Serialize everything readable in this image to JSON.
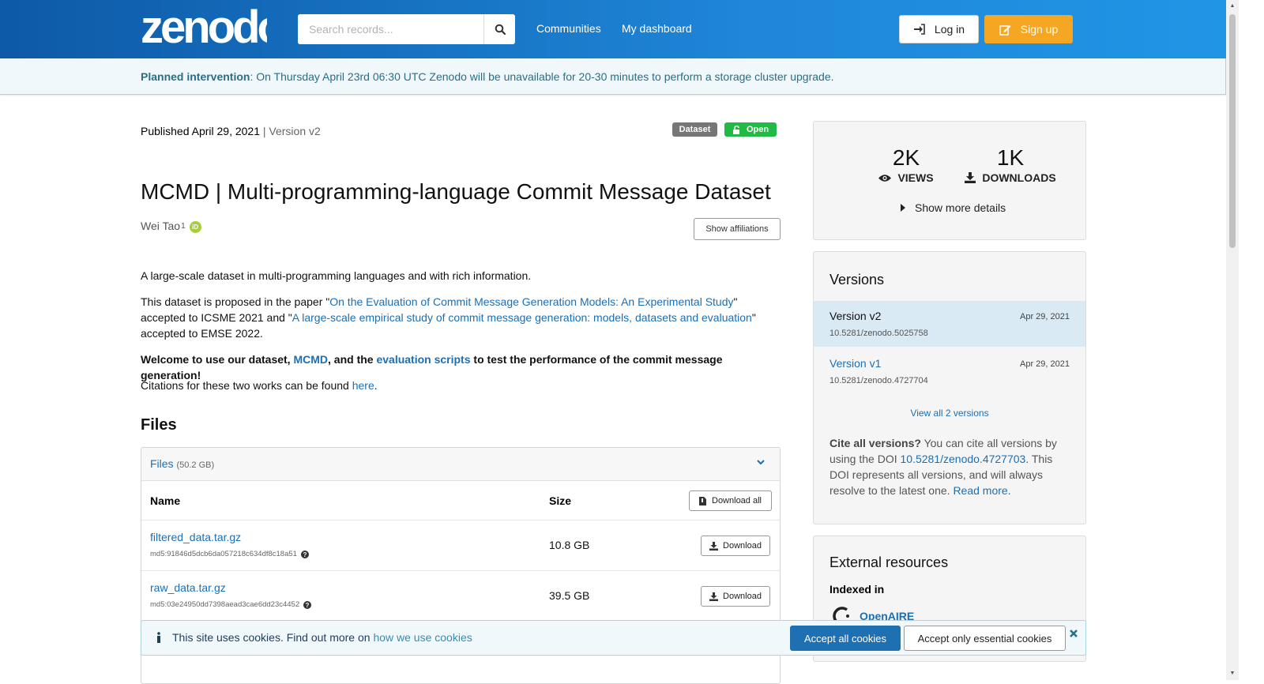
{
  "header": {
    "logo_text": "zenodo",
    "search_placeholder": "Search records...",
    "nav": [
      "Communities",
      "My dashboard"
    ],
    "login_label": "Log in",
    "signup_label": "Sign up"
  },
  "banner": {
    "strong": "Planned intervention",
    "text": ": On Thursday April 23rd 06:30 UTC Zenodo will be unavailable for 20-30 minutes to perform a storage cluster upgrade."
  },
  "record": {
    "published": "Published April 29, 2021",
    "version": "| Version v2",
    "type_badge": "Dataset",
    "access_badge": "Open",
    "title": "MCMD | Multi-programming-language Commit Message Dataset",
    "author": "Wei Tao",
    "author_sup": "1",
    "orcid_label": "iD",
    "affiliations_button": "Show affiliations",
    "desc1": "A large-scale dataset in multi-programming languages and with rich information.",
    "desc2_a": "This dataset is proposed in the paper \"",
    "desc2_link1": "On the Evaluation of Commit Message Generation Models: An Experimental Study",
    "desc2_b": "\" accepted to ICSME 2021 and \"",
    "desc2_link2": "A large-scale empirical study of commit message generation: models, datasets and evaluation",
    "desc2_c": "\" accepted to EMSE 2022.",
    "desc3_a": "Welcome to use our dataset, ",
    "desc3_link1": "MCMD",
    "desc3_b": ", and the ",
    "desc3_link2": "evaluation scripts",
    "desc3_c": " to test the performance of the commit message generation!",
    "desc4_a": "Citations for these two works can be found ",
    "desc4_link": "here",
    "desc4_b": "."
  },
  "files": {
    "heading": "Files",
    "panel_title": "Files",
    "panel_size": "(50.2 GB)",
    "col_name": "Name",
    "col_size": "Size",
    "download_all": "Download all",
    "rows": [
      {
        "name": "filtered_data.tar.gz",
        "md5": "md5:91846d5dcb6da057218c634df8c18a51",
        "size": "10.8 GB",
        "action": "Download"
      },
      {
        "name": "raw_data.tar.gz",
        "md5": "md5:03e24950dd7398aead3cae6dd23c4452",
        "size": "39.5 GB",
        "action": "Download"
      }
    ]
  },
  "stats": {
    "views_count": "2K",
    "views_label": "VIEWS",
    "downloads_count": "1K",
    "downloads_label": "DOWNLOADS",
    "more_label": "Show more details"
  },
  "versions": {
    "heading": "Versions",
    "items": [
      {
        "name": "Version v2",
        "date": "Apr 29, 2021",
        "doi": "10.5281/zenodo.5025758"
      },
      {
        "name": "Version v1",
        "date": "Apr 29, 2021",
        "doi": "10.5281/zenodo.4727704"
      }
    ],
    "view_all": "View all 2 versions",
    "cite_strong": "Cite all versions?",
    "cite_a": " You can cite all versions by using the DOI ",
    "cite_doi": "10.5281/zenodo.4727703",
    "cite_b": ". This DOI represents all versions, and will always resolve to the latest one. ",
    "cite_link": "Read more."
  },
  "external": {
    "heading": "External resources",
    "indexed_in": "Indexed in",
    "openaire": "OpenAIRE"
  },
  "cookie": {
    "msg": "This site uses cookies. Find out more on ",
    "link": "how we use cookies",
    "accept_all": "Accept all cookies",
    "accept_essential": "Accept only essential cookies"
  },
  "colors": {
    "header_start": "#0d5aa7",
    "header_end": "#2196e6",
    "link": "#1a6fb5",
    "signup": "#f5a623",
    "open_badge": "#21ba45",
    "accept_button": "#1f6fb3"
  }
}
